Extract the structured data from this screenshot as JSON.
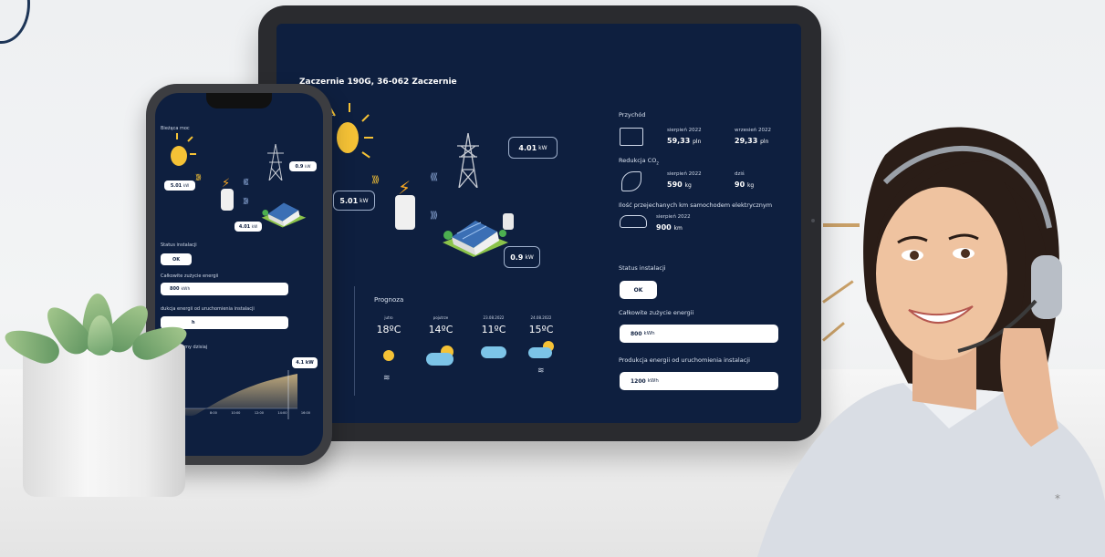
{
  "tablet": {
    "address": "Zaczernie 190G, 36-062 Zaczernie",
    "current_power_label": "oc",
    "power_values": {
      "panel": "5.01",
      "grid": "4.01",
      "home": "0.9",
      "unit": "kW"
    },
    "forecast": {
      "title": "Prognoza",
      "days": [
        {
          "day": "jutro",
          "temp": "18ºC",
          "icon": "sun-icon"
        },
        {
          "day": "pojutrze",
          "temp": "14ºC",
          "icon": "partly-cloudy-icon"
        },
        {
          "day": "23.08.2022",
          "temp": "11ºC",
          "icon": "cloud-icon"
        },
        {
          "day": "24.08.2022",
          "temp": "15ºC",
          "icon": "partly-cloudy-icon"
        }
      ]
    },
    "revenue": {
      "title": "Przychód",
      "items": [
        {
          "label": "sierpień 2022",
          "value": "59,33",
          "unit": "pln"
        },
        {
          "label": "wrzesień 2022",
          "value": "29,33",
          "unit": "pln"
        }
      ]
    },
    "co2": {
      "title": "Redukcja CO",
      "sub": "2",
      "items": [
        {
          "label": "sierpień 2022",
          "value": "590",
          "unit": "kg"
        },
        {
          "label": "dziś",
          "value": "90",
          "unit": "kg"
        }
      ]
    },
    "ev": {
      "title": "Ilość przejechanych km samochodem elektrycznym",
      "label": "sierpień 2022",
      "value": "900",
      "unit": "km"
    },
    "status": {
      "title": "Status instalacji",
      "value": "OK"
    },
    "total_consumption": {
      "title": "Całkowite zużycie energii",
      "value": "800",
      "unit": "kWh"
    },
    "production": {
      "title": "Produkcja energii od uruchomienia instalacji",
      "value": "1200",
      "unit": "kWh"
    }
  },
  "phone": {
    "current_power_label": "Bieżąca moc",
    "power_values": {
      "panel": "5.01",
      "grid": "0.9",
      "home": "4.01",
      "unit": "kW"
    },
    "status": {
      "title": "Status instalacji",
      "value": "OK"
    },
    "total_consumption": {
      "title": "Całkowite zużycie energii",
      "value": "800",
      "unit": "kWh"
    },
    "production": {
      "title": "dukcja energii od uruchomienia instalacji",
      "value": "h"
    },
    "balance": {
      "title": "energetyczny dzisiaj",
      "peak": "4.1 kW",
      "ticks": [
        "8:00",
        "10:00",
        "12:00",
        "14:00",
        "16:00"
      ]
    }
  },
  "colors": {
    "screen_bg": "#0e1f3f",
    "sun": "#f5c236",
    "accent_blue": "#7cc4e8"
  }
}
